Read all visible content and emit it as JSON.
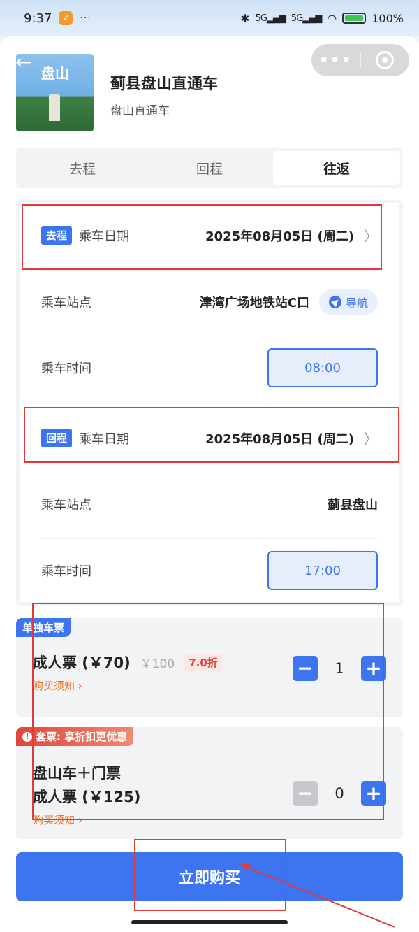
{
  "status_bar": {
    "time": "9:37",
    "dots": "···",
    "signal_1": "5G",
    "signal_2": "5G",
    "battery": "100%"
  },
  "header": {
    "title": "蓟县盘山直通车",
    "subtitle": "盘山直通车",
    "thumb_text": "盘山"
  },
  "tabs": [
    {
      "label": "去程",
      "active": false
    },
    {
      "label": "回程",
      "active": false
    },
    {
      "label": "往返",
      "active": true
    }
  ],
  "outbound": {
    "chip": "去程",
    "date_label": "乘车日期",
    "date_value": "2025年08月05日 (周二)",
    "station_label": "乘车站点",
    "station_value": "津湾广场地铁站C口",
    "nav_label": "导航",
    "time_label": "乘车时间",
    "time_value": "08:00"
  },
  "return": {
    "chip": "回程",
    "date_label": "乘车日期",
    "date_value": "2025年08月05日 (周二)",
    "station_label": "乘车站点",
    "station_value": "蓟县盘山",
    "time_label": "乘车时间",
    "time_value": "17:00"
  },
  "ticket_single": {
    "tag": "单独车票",
    "name": "成人票 (￥70)",
    "old_price": "￥100",
    "discount": "7.0折",
    "notice": "购买须知 ›",
    "quantity": "1"
  },
  "ticket_combo": {
    "tag": "套票: 享折扣更优惠",
    "name_line1": "盘山车＋门票",
    "name_line2": "成人票 (￥125)",
    "notice": "购买须知 ›",
    "quantity": "0"
  },
  "stepper": {
    "minus": "−",
    "plus": "+"
  },
  "buy_button": "立即购买"
}
